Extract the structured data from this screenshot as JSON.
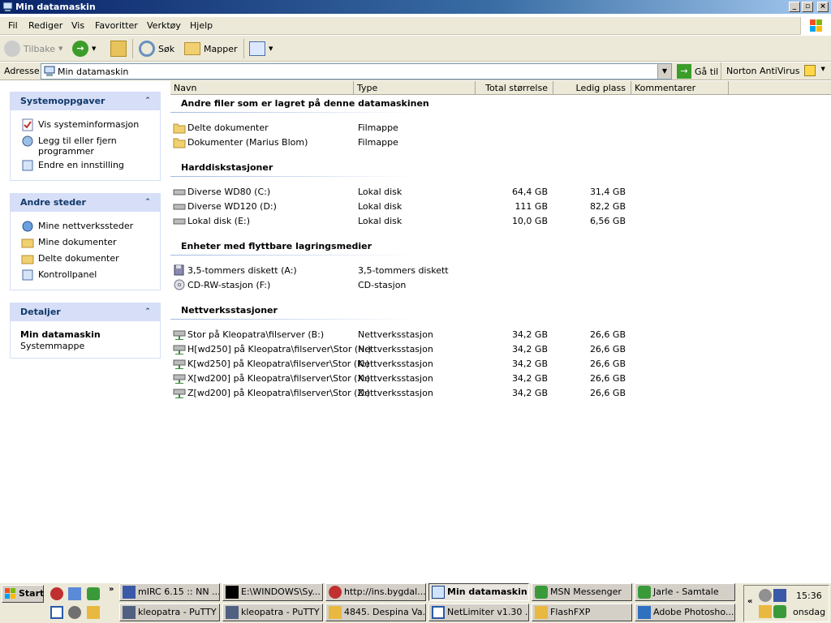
{
  "window": {
    "title": "Min datamaskin"
  },
  "menubar": {
    "items": [
      "Fil",
      "Rediger",
      "Vis",
      "Favoritter",
      "Verktøy",
      "Hjelp"
    ]
  },
  "toolbar": {
    "back": "Tilbake",
    "search": "Søk",
    "folders": "Mapper"
  },
  "address": {
    "label": "Adresse",
    "value": "Min datamaskin",
    "go": "Gå til",
    "norton": "Norton AntiVirus"
  },
  "columns": {
    "name": "Navn",
    "type": "Type",
    "total": "Total størrelse",
    "free": "Ledig plass",
    "comments": "Kommentarer"
  },
  "leftpane": {
    "tasks": {
      "title": "Systemoppgaver",
      "items": [
        "Vis systeminformasjon",
        "Legg til eller fjern programmer",
        "Endre en innstilling"
      ]
    },
    "places": {
      "title": "Andre steder",
      "items": [
        "Mine nettverkssteder",
        "Mine dokumenter",
        "Delte dokumenter",
        "Kontrollpanel"
      ]
    },
    "details": {
      "title": "Detaljer",
      "name": "Min datamaskin",
      "sub": "Systemmappe"
    }
  },
  "groups": {
    "files": {
      "title": "Andre filer som er lagret på denne datamaskinen",
      "rows": [
        {
          "name": "Delte dokumenter",
          "type": "Filmappe",
          "total": "",
          "free": ""
        },
        {
          "name": "Dokumenter (Marius Blom)",
          "type": "Filmappe",
          "total": "",
          "free": ""
        }
      ]
    },
    "hdd": {
      "title": "Harddiskstasjoner",
      "rows": [
        {
          "name": "Diverse WD80 (C:)",
          "type": "Lokal disk",
          "total": "64,4 GB",
          "free": "31,4 GB"
        },
        {
          "name": "Diverse WD120 (D:)",
          "type": "Lokal disk",
          "total": "111 GB",
          "free": "82,2 GB"
        },
        {
          "name": "Lokal disk (E:)",
          "type": "Lokal disk",
          "total": "10,0 GB",
          "free": "6,56 GB"
        }
      ]
    },
    "removable": {
      "title": "Enheter med flyttbare lagringsmedier",
      "rows": [
        {
          "name": "3,5-tommers diskett (A:)",
          "type": "3,5-tommers diskett",
          "total": "",
          "free": ""
        },
        {
          "name": "CD-RW-stasjon (F:)",
          "type": "CD-stasjon",
          "total": "",
          "free": ""
        }
      ]
    },
    "network": {
      "title": "Nettverksstasjoner",
      "rows": [
        {
          "name": "Stor på Kleopatra\\filserver (B:)",
          "type": "Nettverksstasjon",
          "total": "34,2 GB",
          "free": "26,6 GB"
        },
        {
          "name": "H[wd250] på Kleopatra\\filserver\\Stor (H:)",
          "type": "Nettverksstasjon",
          "total": "34,2 GB",
          "free": "26,6 GB"
        },
        {
          "name": "K[wd250] på Kleopatra\\filserver\\Stor (K:)",
          "type": "Nettverksstasjon",
          "total": "34,2 GB",
          "free": "26,6 GB"
        },
        {
          "name": "X[wd200] på Kleopatra\\filserver\\Stor (X:)",
          "type": "Nettverksstasjon",
          "total": "34,2 GB",
          "free": "26,6 GB"
        },
        {
          "name": "Z[wd200] på Kleopatra\\filserver\\Stor (Z:)",
          "type": "Nettverksstasjon",
          "total": "34,2 GB",
          "free": "26,6 GB"
        }
      ]
    }
  },
  "taskbar": {
    "start": "Start",
    "tasks": [
      "mIRC 6.15 :: NN ...",
      "E:\\WINDOWS\\Sy...",
      "http://ins.bygdal...",
      "Min datamaskin",
      "MSN Messenger",
      "Jarle - Samtale",
      "kleopatra - PuTTY",
      "kleopatra - PuTTY",
      "4845. Despina Va...",
      "NetLimiter v1.30 ...",
      "FlashFXP",
      "Adobe Photosho..."
    ],
    "clock": "15:36",
    "day": "onsdag"
  }
}
